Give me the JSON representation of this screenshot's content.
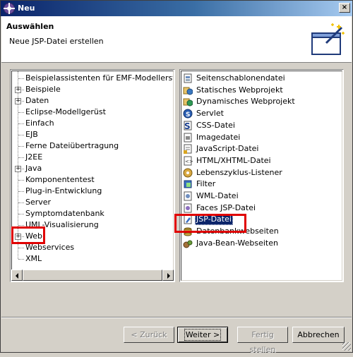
{
  "window": {
    "title": "Neu",
    "close_symbol": "×"
  },
  "header": {
    "title": "Auswählen",
    "description": "Neue JSP-Datei erstellen"
  },
  "left_tree": {
    "items": [
      {
        "label": "Beispielassistenten für EMF-Modellerstellung",
        "expandable": false
      },
      {
        "label": "Beispiele",
        "expandable": true
      },
      {
        "label": "Daten",
        "expandable": true
      },
      {
        "label": "Eclipse-Modellgerüst",
        "expandable": false
      },
      {
        "label": "Einfach",
        "expandable": false
      },
      {
        "label": "EJB",
        "expandable": false
      },
      {
        "label": "Ferne Dateiübertragung",
        "expandable": false
      },
      {
        "label": "J2EE",
        "expandable": false
      },
      {
        "label": "Java",
        "expandable": true
      },
      {
        "label": "Komponententest",
        "expandable": false
      },
      {
        "label": "Plug-in-Entwicklung",
        "expandable": false
      },
      {
        "label": "Server",
        "expandable": false
      },
      {
        "label": "Symptomdatenbank",
        "expandable": false
      },
      {
        "label": "UML-Visualisierung",
        "expandable": false
      },
      {
        "label": "Web",
        "expandable": true
      },
      {
        "label": "Webservices",
        "expandable": false
      },
      {
        "label": "XML",
        "expandable": false
      }
    ],
    "expander_symbol": "+"
  },
  "right_list": {
    "items": [
      {
        "label": "Seitenschablonendatei",
        "icon": "page-template-icon"
      },
      {
        "label": "Statisches Webprojekt",
        "icon": "static-web-project-icon"
      },
      {
        "label": "Dynamisches Webprojekt",
        "icon": "dynamic-web-project-icon"
      },
      {
        "label": "Servlet",
        "icon": "servlet-icon"
      },
      {
        "label": "CSS-Datei",
        "icon": "css-file-icon"
      },
      {
        "label": "Imagedatei",
        "icon": "image-file-icon"
      },
      {
        "label": "JavaScript-Datei",
        "icon": "javascript-file-icon"
      },
      {
        "label": "HTML/XHTML-Datei",
        "icon": "html-file-icon"
      },
      {
        "label": "Lebenszyklus-Listener",
        "icon": "lifecycle-listener-icon"
      },
      {
        "label": "Filter",
        "icon": "filter-icon"
      },
      {
        "label": "WML-Datei",
        "icon": "wml-file-icon"
      },
      {
        "label": "Faces JSP-Datei",
        "icon": "faces-jsp-file-icon"
      },
      {
        "label": "JSP-Datei",
        "icon": "jsp-file-icon",
        "selected": true
      },
      {
        "label": "Datenbankwebseiten",
        "icon": "database-web-pages-icon"
      },
      {
        "label": "Java-Bean-Webseiten",
        "icon": "java-bean-web-pages-icon"
      }
    ]
  },
  "buttons": {
    "back": {
      "label": "< Zurück",
      "enabled": false
    },
    "next": {
      "label": "Weiter >",
      "enabled": true
    },
    "finish": {
      "label": "Fertig stellen",
      "enabled": false
    },
    "cancel": {
      "label": "Abbrechen",
      "enabled": true
    }
  },
  "colors": {
    "highlight": "#e00000",
    "selection": "#0a246a",
    "title_bar": "#0a246a"
  }
}
